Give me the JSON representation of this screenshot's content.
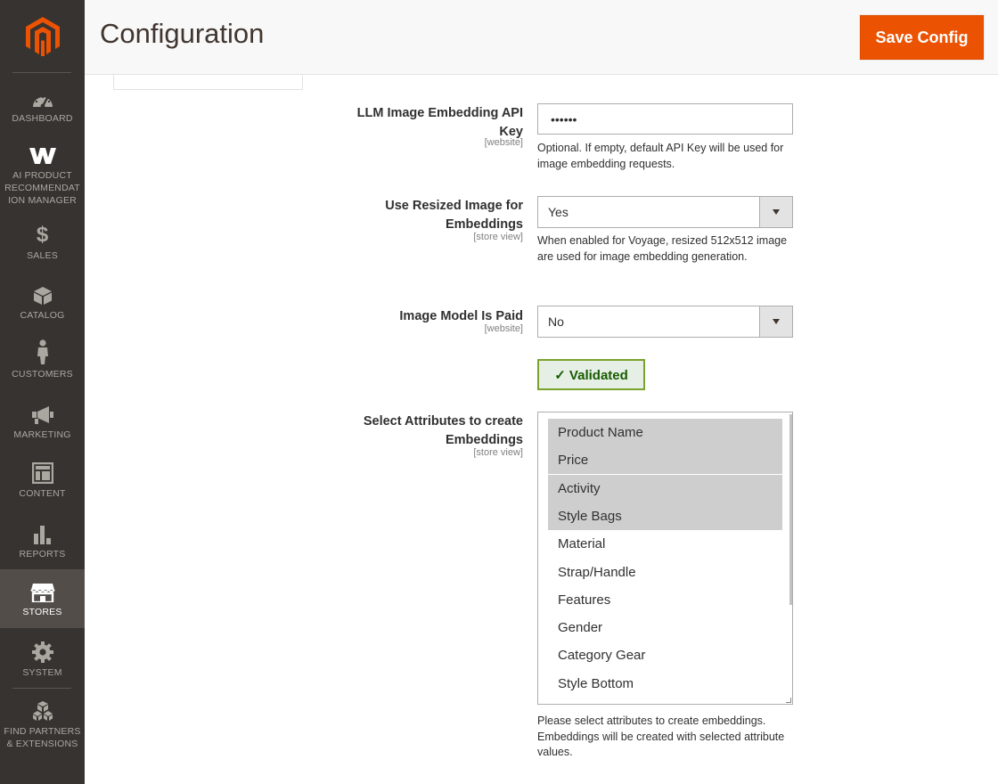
{
  "header": {
    "title": "Configuration",
    "save_label": "Save Config"
  },
  "sidebar": {
    "logo_icon": "magento-logo-icon",
    "brand_color": "#eb5202",
    "items": [
      {
        "label": "DASHBOARD",
        "icon": "dashboard-icon"
      },
      {
        "label": "AI PRODUCT RECOMMENDAT ION MANAGER",
        "icon": "w-logo-icon"
      },
      {
        "label": "SALES",
        "icon": "dollar-icon"
      },
      {
        "label": "CATALOG",
        "icon": "cube-icon"
      },
      {
        "label": "CUSTOMERS",
        "icon": "person-icon"
      },
      {
        "label": "MARKETING",
        "icon": "megaphone-icon"
      },
      {
        "label": "CONTENT",
        "icon": "layout-icon"
      },
      {
        "label": "REPORTS",
        "icon": "bar-chart-icon"
      },
      {
        "label": "STORES",
        "icon": "storefront-icon",
        "active": true
      },
      {
        "label": "SYSTEM",
        "icon": "gear-icon"
      },
      {
        "label": "FIND PARTNERS & EXTENSIONS",
        "icon": "boxes-icon"
      }
    ]
  },
  "form": {
    "api_key": {
      "label": "LLM Image Embedding API Key",
      "scope": "[website]",
      "value": "••••••",
      "note": "Optional. If empty, default API Key will be used for image embedding requests."
    },
    "resized_image": {
      "label": "Use Resized Image for Embeddings",
      "scope": "[store view]",
      "value": "Yes",
      "note": "When enabled for Voyage, resized 512x512 image are used for image embedding generation."
    },
    "model_paid": {
      "label": "Image Model Is Paid",
      "scope": "[website]",
      "value": "No"
    },
    "validated": {
      "label": "✓ Validated",
      "color": "#185b00"
    },
    "attributes": {
      "label": "Select Attributes to create Embeddings",
      "scope": "[store view]",
      "options": [
        {
          "label": "Product Name",
          "selected": true
        },
        {
          "label": "Price",
          "selected": true
        },
        {
          "label": "Activity",
          "selected": true
        },
        {
          "label": "Style Bags",
          "selected": true
        },
        {
          "label": "Material",
          "selected": false
        },
        {
          "label": "Strap/Handle",
          "selected": false
        },
        {
          "label": "Features",
          "selected": false
        },
        {
          "label": "Gender",
          "selected": false
        },
        {
          "label": "Category Gear",
          "selected": false
        },
        {
          "label": "Style Bottom",
          "selected": false
        }
      ],
      "note": "Please select attributes to create embeddings. Embeddings will be created with selected attribute values."
    }
  }
}
